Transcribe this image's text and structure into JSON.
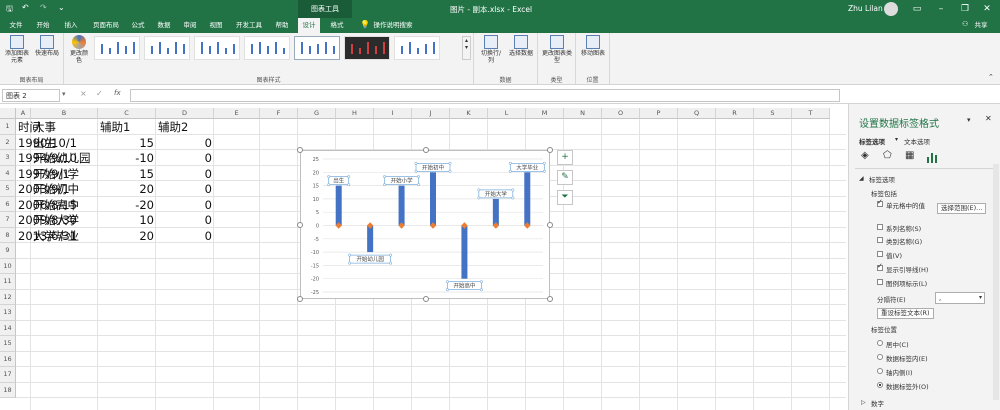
{
  "titlebar": {
    "context_tab": "图表工具",
    "doc_title": "图片 - 副本.xlsx - Excel",
    "user": "Zhu Lilan",
    "share": "共享"
  },
  "tabs": [
    "文件",
    "开始",
    "插入",
    "页面布局",
    "公式",
    "数据",
    "审阅",
    "视图",
    "开发工具",
    "帮助",
    "设计",
    "格式"
  ],
  "tell_me": "操作说明搜索",
  "ribbon": {
    "add_element": "添加图表元素",
    "quick_layout": "快速布局",
    "change_color": "更改颜色",
    "layouts_group": "图表布局",
    "styles_group": "图表样式",
    "switch_rowcol": "切换行/列",
    "select_data": "选择数据",
    "data_group": "数据",
    "change_type": "更改图表类型",
    "type_group": "类型",
    "move_chart": "移动图表",
    "position_group": "位置"
  },
  "formula": {
    "namebox": "图表 2",
    "cancel": "×",
    "confirm": "✓",
    "fx": "fx"
  },
  "columns": [
    "A",
    "B",
    "C",
    "D",
    "E",
    "F",
    "G",
    "H",
    "I",
    "J",
    "K",
    "L",
    "M",
    "N",
    "O",
    "P",
    "Q",
    "R",
    "S",
    "T"
  ],
  "rows": [
    "1",
    "2",
    "3",
    "4",
    "5",
    "6",
    "7",
    "8",
    "9",
    "10",
    "11",
    "12",
    "13",
    "14",
    "15",
    "16",
    "17",
    "18"
  ],
  "table": {
    "headers": [
      "时间",
      "大事",
      "辅助1",
      "辅助2"
    ],
    "rows": [
      [
        "1990/10/1",
        "出生",
        "15",
        "0"
      ],
      [
        "1994/9/10",
        "开始幼儿园",
        "-10",
        "0"
      ],
      [
        "1997/9/1",
        "开始小学",
        "15",
        "0"
      ],
      [
        "2003/9/1",
        "开始初中",
        "20",
        "0"
      ],
      [
        "2006/8/15",
        "开始高中",
        "-20",
        "0"
      ],
      [
        "2009/8/30",
        "开始大学",
        "10",
        "0"
      ],
      [
        "2013/6/31",
        "大学毕业",
        "20",
        "0"
      ]
    ]
  },
  "chart_data": {
    "type": "bar",
    "categories": [
      "出生",
      "开始幼儿园",
      "开始小学",
      "开始初中",
      "开始高中",
      "开始大学",
      "大学毕业"
    ],
    "values": [
      15,
      -10,
      15,
      20,
      -20,
      10,
      20
    ],
    "ylim": [
      -25,
      25
    ],
    "yticks": [
      "25",
      "20",
      "15",
      "10",
      "5",
      "0",
      "-5",
      "-10",
      "-15",
      "-20",
      "-25"
    ],
    "grid": true,
    "colors": {
      "bar": "#4472c4",
      "marker": "#ed7d31"
    }
  },
  "pane": {
    "title": "设置数据标签格式",
    "tab_label_options": "标签选项",
    "tab_text_options": "文本选项",
    "section": "标签选项",
    "contains": "标签包括",
    "cb_cell_value": "单元格中的值",
    "select_range": "选择范围(E)...",
    "cb_series": "系列名称(S)",
    "cb_category": "类别名称(G)",
    "cb_value": "值(V)",
    "cb_leader": "显示引导线(H)",
    "cb_legend": "图例项标示(L)",
    "separator_label": "分隔符(E)",
    "separator_value": ",",
    "reset_text": "重设标签文本(R)",
    "position_label": "标签位置",
    "pos_center": "居中(C)",
    "pos_inside_end": "数据标签内(E)",
    "pos_inside_base": "轴内侧(I)",
    "pos_outside_end": "数据标签外(O)",
    "number": "数字"
  }
}
